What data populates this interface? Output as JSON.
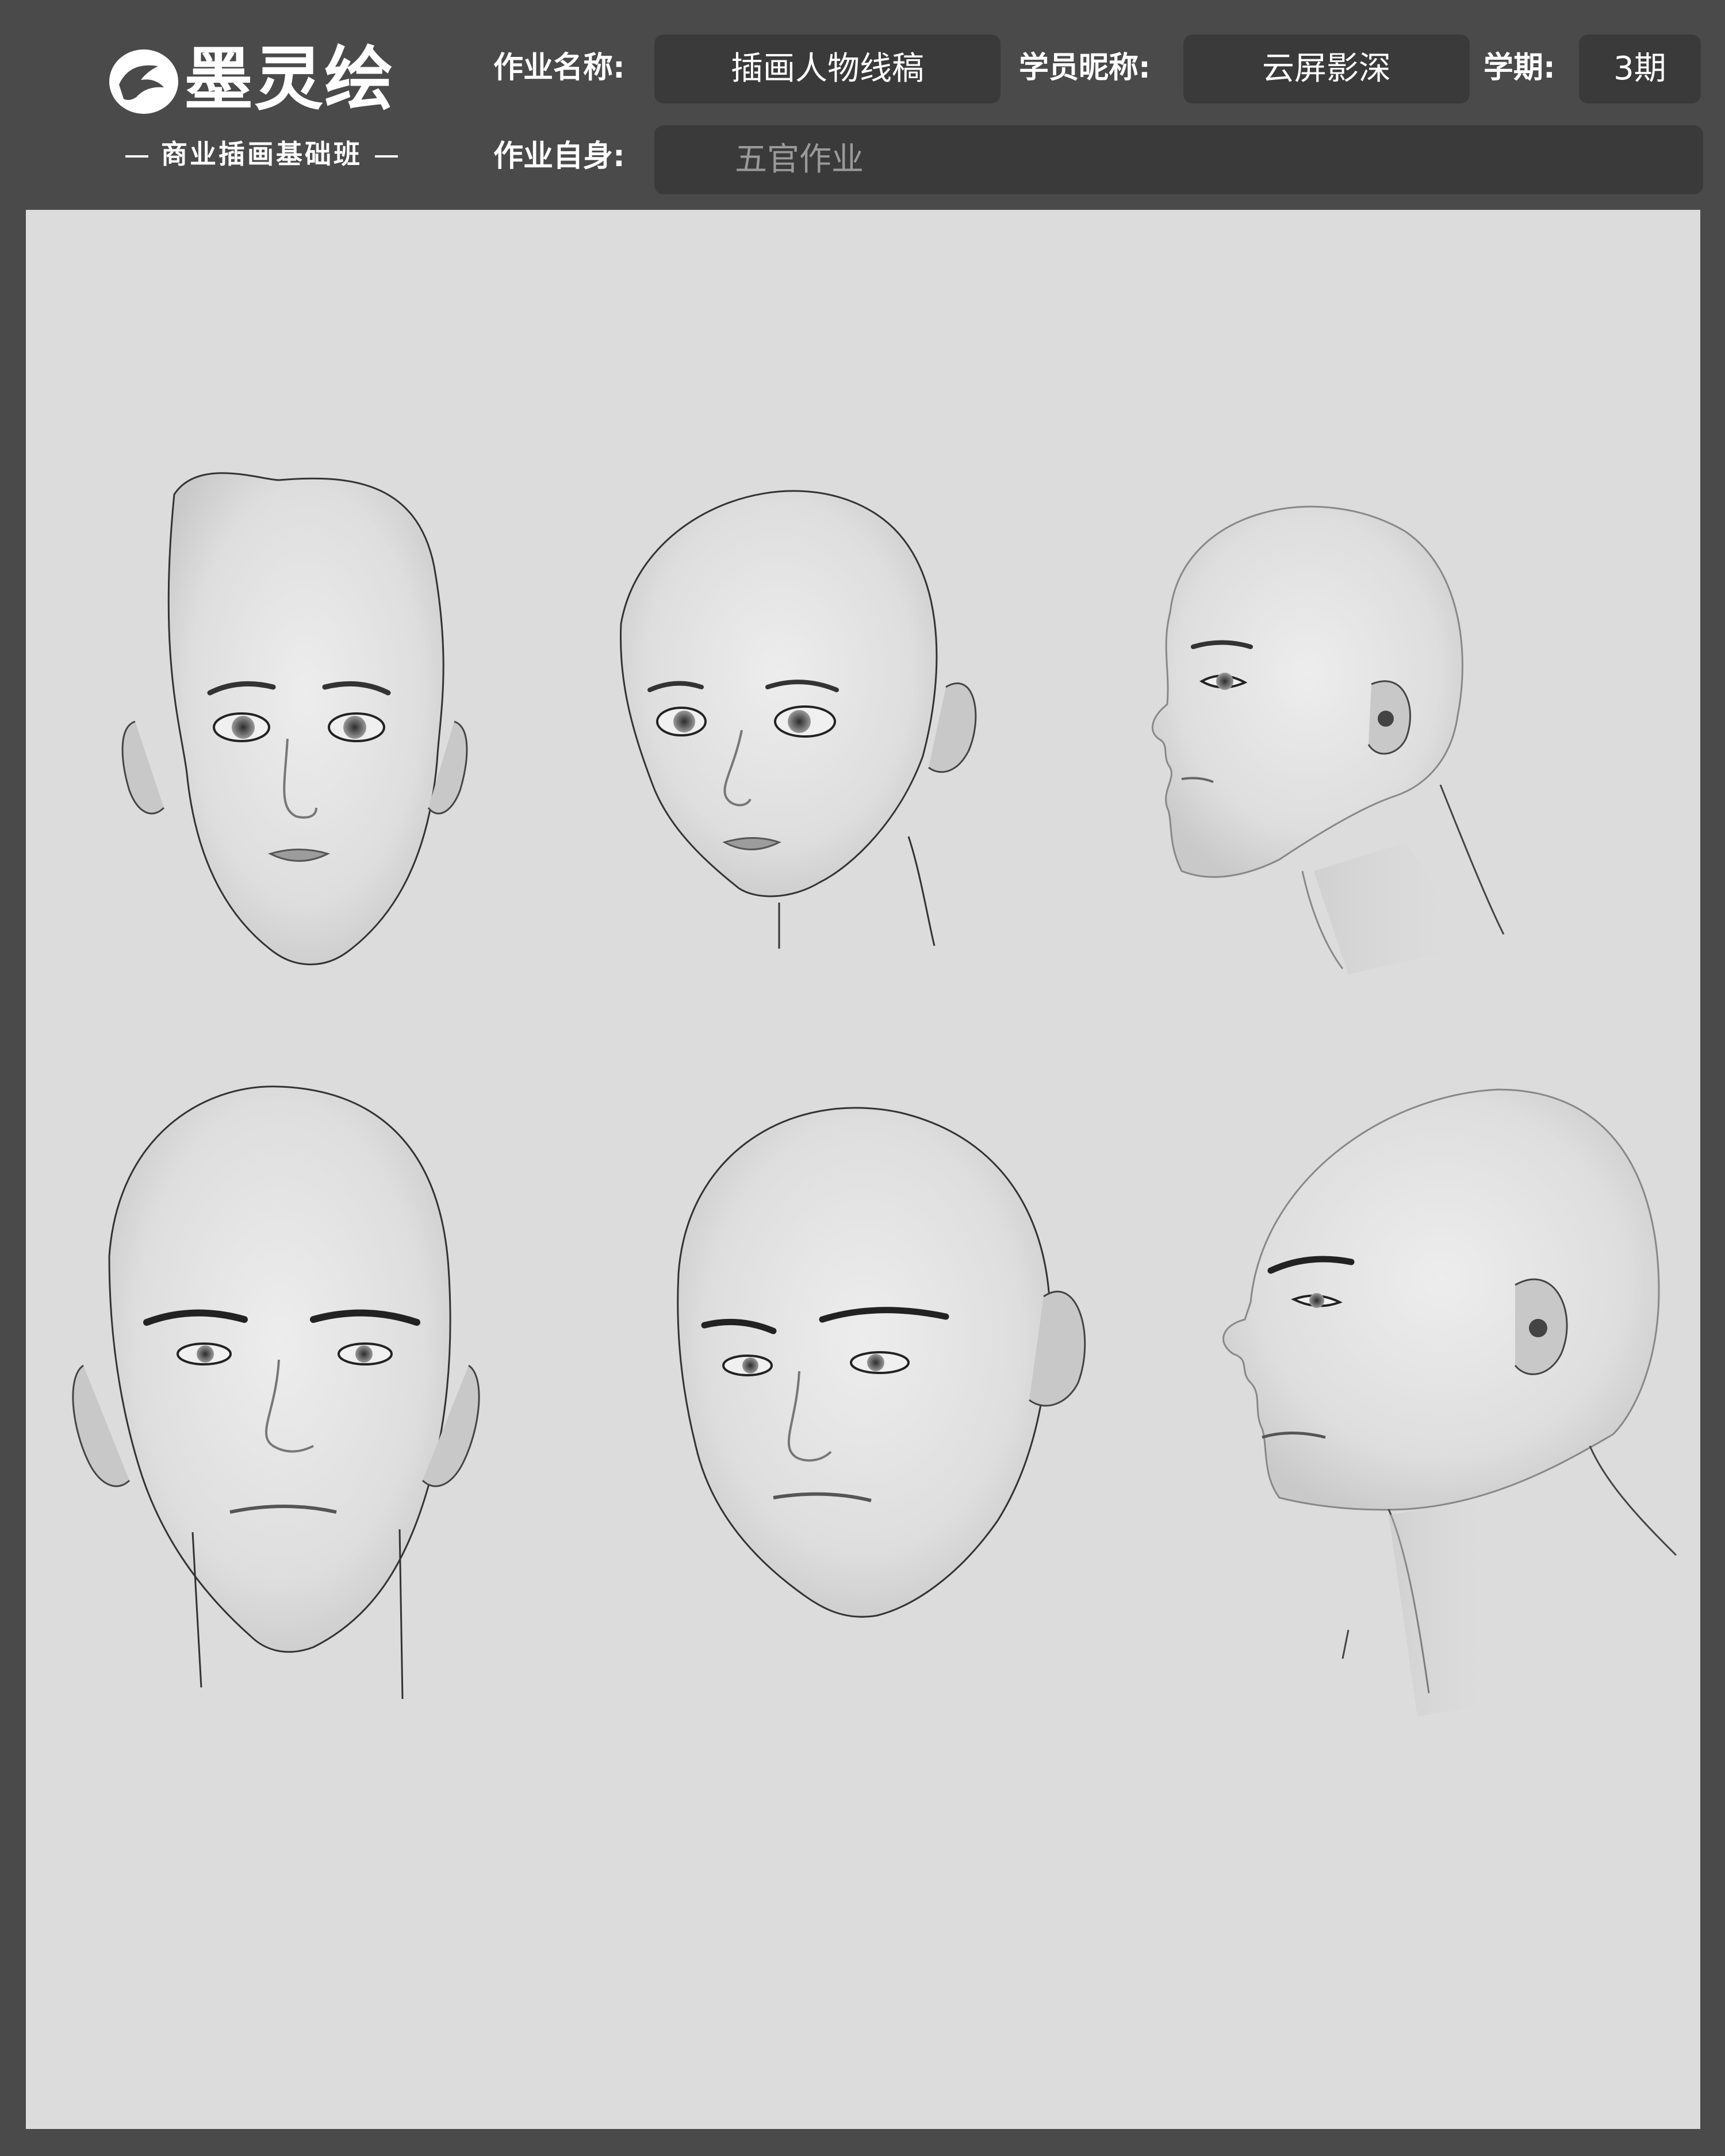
{
  "header": {
    "logo": {
      "title": "墨灵绘",
      "subtitle": "商业插画基础班"
    },
    "assignment_name_label": "作业名称:",
    "assignment_name_value": "插画人物线稿",
    "student_nickname_label": "学员昵称:",
    "student_nickname_value": "云屏影深",
    "term_label": "学期:",
    "term_value": "3期",
    "assignment_self_label": "作业自身:",
    "assignment_self_value": "五官作业"
  },
  "artwork": {
    "background_color": "#dcdcdc",
    "heads": [
      {
        "view": "front",
        "style": "female"
      },
      {
        "view": "three-quarter",
        "style": "female"
      },
      {
        "view": "profile",
        "style": "female"
      },
      {
        "view": "front",
        "style": "male"
      },
      {
        "view": "three-quarter",
        "style": "male"
      },
      {
        "view": "profile",
        "style": "male"
      }
    ]
  },
  "colors": {
    "frame": "#4b4a4b",
    "field_box": "#3a3a3a",
    "logo_accent_blue": "#3ac7e8",
    "logo_accent_yellow": "#f6d21a"
  }
}
